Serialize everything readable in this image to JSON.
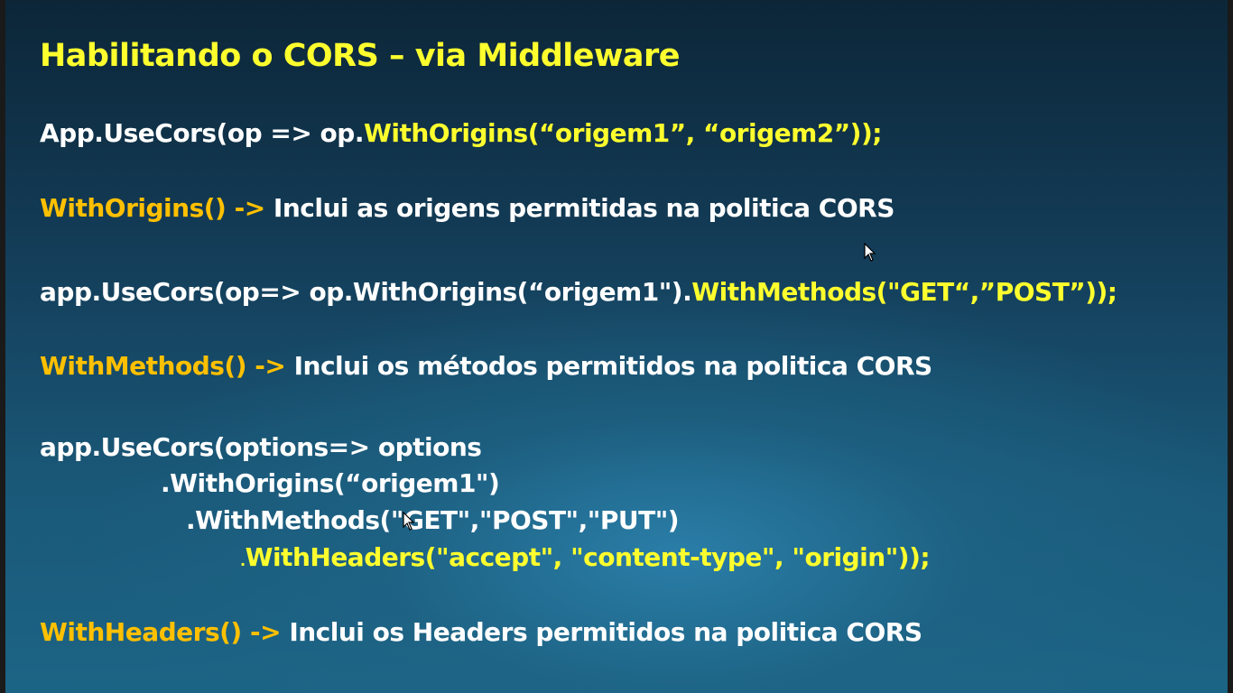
{
  "slide": {
    "title": "Habilitando o CORS – via Middleware",
    "lines": {
      "l1": {
        "a": "App.UseCors(op => op.",
        "b": "WithOrigins(“origem1”, “origem2”));"
      },
      "l2": {
        "a": "WithOrigins() -> ",
        "b": "Inclui as origens permitidas na politica CORS"
      },
      "l3": {
        "a": "app.UseCors(op=> op.WithOrigins(“origem1\").",
        "b": "WithMethods(\"GET“,”POST”));"
      },
      "l4": {
        "a": "WithMethods() -> ",
        "b": "Inclui os métodos permitidos na politica CORS"
      },
      "l5": "app.UseCors(options=> options",
      "l6": ".WithOrigins(“origem1\")",
      "l7": ".WithMethods(\"GET\",\"POST\",\"PUT\")",
      "l8": {
        "a": ".",
        "b": "WithHeaders(\"accept\", \"content-type\", \"origin\"));"
      },
      "l9": {
        "a": "WithHeaders() -> ",
        "b": "Inclui os Headers permitidos na politica CORS"
      }
    }
  },
  "colors": {
    "title": "#ffff2e",
    "code_highlight": "#ffff2e",
    "method_name": "#ffc000",
    "text": "#ffffff",
    "background_top": "#0c2638",
    "background_bottom": "#1c6485"
  },
  "icons": {
    "pointer": "mouse-pointer-icon"
  }
}
